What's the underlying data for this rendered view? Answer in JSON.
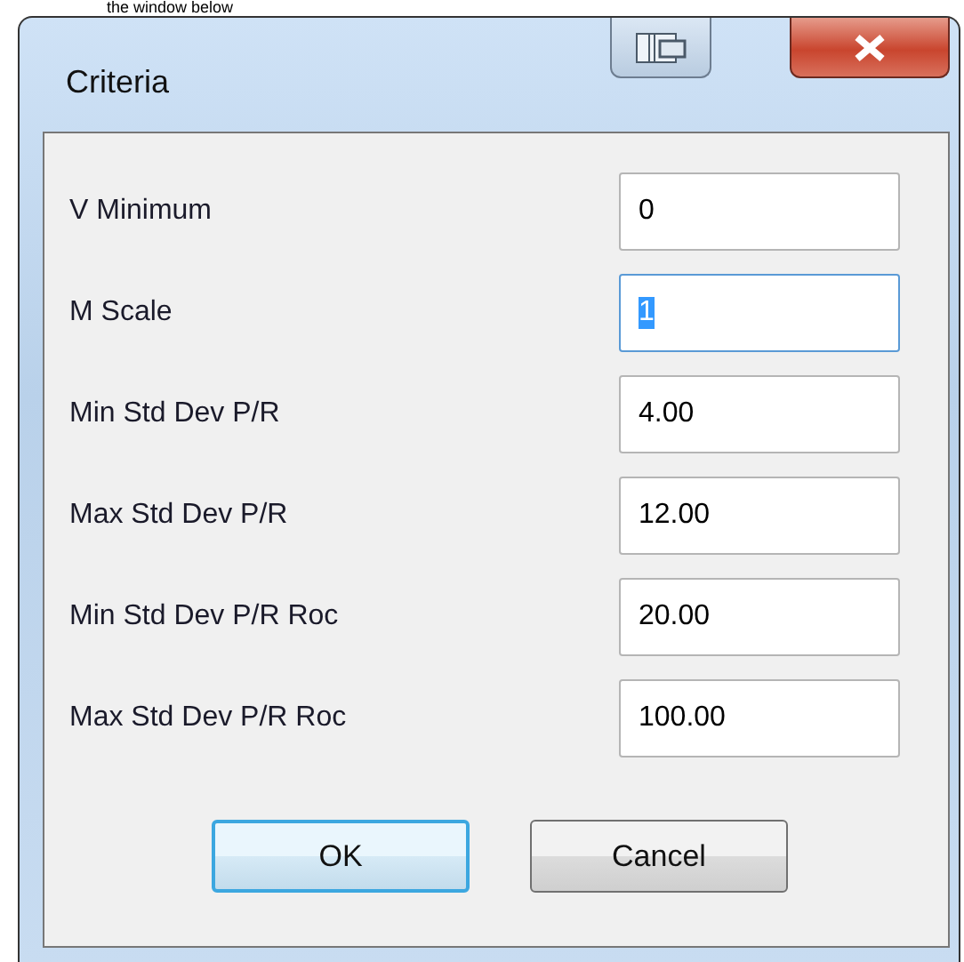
{
  "caption": "the window below",
  "window": {
    "title": "Criteria"
  },
  "fields": [
    {
      "label": "V Minimum",
      "value": "0",
      "focused": false
    },
    {
      "label": "M Scale",
      "value": "1",
      "focused": true
    },
    {
      "label": "Min Std Dev P/R",
      "value": "4.00",
      "focused": false
    },
    {
      "label": "Max Std Dev P/R",
      "value": "12.00",
      "focused": false
    },
    {
      "label": "Min Std Dev P/R Roc",
      "value": "20.00",
      "focused": false
    },
    {
      "label": "Max Std Dev P/R Roc",
      "value": "100.00",
      "focused": false
    }
  ],
  "buttons": [
    {
      "label": "OK",
      "default": true
    },
    {
      "label": "Cancel",
      "default": false
    }
  ]
}
